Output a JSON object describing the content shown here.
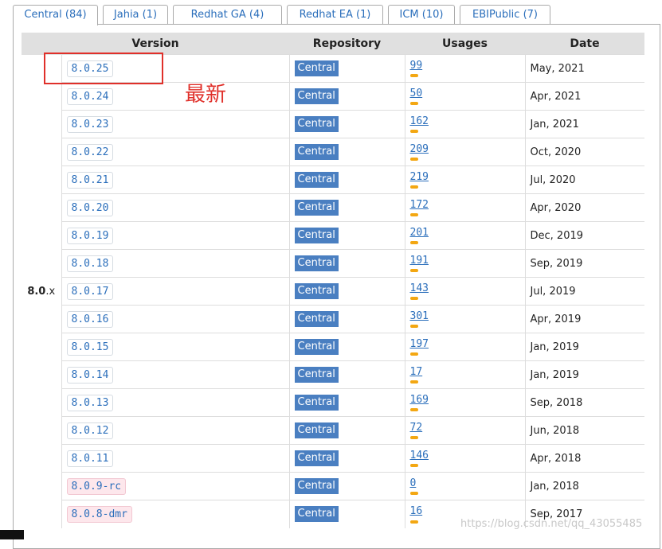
{
  "tabs": [
    {
      "label": "Central (84)",
      "active": true
    },
    {
      "label": "Jahia (1)",
      "active": false
    },
    {
      "label": "Redhat GA (4)",
      "active": false
    },
    {
      "label": "Redhat EA (1)",
      "active": false
    },
    {
      "label": "ICM (10)",
      "active": false
    },
    {
      "label": "EBIPublic (7)",
      "active": false
    }
  ],
  "table": {
    "headers": {
      "version": "Version",
      "repository": "Repository",
      "usages": "Usages",
      "date": "Date"
    },
    "group": {
      "major": "8.0",
      "suffix": ".x"
    },
    "rows": [
      {
        "version": "8.0.25",
        "repo": "Central",
        "usages": "99",
        "date": "May, 2021"
      },
      {
        "version": "8.0.24",
        "repo": "Central",
        "usages": "50",
        "date": "Apr, 2021"
      },
      {
        "version": "8.0.23",
        "repo": "Central",
        "usages": "162",
        "date": "Jan, 2021"
      },
      {
        "version": "8.0.22",
        "repo": "Central",
        "usages": "209",
        "date": "Oct, 2020"
      },
      {
        "version": "8.0.21",
        "repo": "Central",
        "usages": "219",
        "date": "Jul, 2020"
      },
      {
        "version": "8.0.20",
        "repo": "Central",
        "usages": "172",
        "date": "Apr, 2020"
      },
      {
        "version": "8.0.19",
        "repo": "Central",
        "usages": "201",
        "date": "Dec, 2019"
      },
      {
        "version": "8.0.18",
        "repo": "Central",
        "usages": "191",
        "date": "Sep, 2019"
      },
      {
        "version": "8.0.17",
        "repo": "Central",
        "usages": "143",
        "date": "Jul, 2019"
      },
      {
        "version": "8.0.16",
        "repo": "Central",
        "usages": "301",
        "date": "Apr, 2019"
      },
      {
        "version": "8.0.15",
        "repo": "Central",
        "usages": "197",
        "date": "Jan, 2019"
      },
      {
        "version": "8.0.14",
        "repo": "Central",
        "usages": "17",
        "date": "Jan, 2019"
      },
      {
        "version": "8.0.13",
        "repo": "Central",
        "usages": "169",
        "date": "Sep, 2018"
      },
      {
        "version": "8.0.12",
        "repo": "Central",
        "usages": "72",
        "date": "Jun, 2018"
      },
      {
        "version": "8.0.11",
        "repo": "Central",
        "usages": "146",
        "date": "Apr, 2018"
      },
      {
        "version": "8.0.9-rc",
        "repo": "Central",
        "usages": "0",
        "date": "Jan, 2018",
        "prerelease": true
      },
      {
        "version": "8.0.8-dmr",
        "repo": "Central",
        "usages": "16",
        "date": "Sep, 2017",
        "prerelease": true
      }
    ]
  },
  "annotation": {
    "label": "最新"
  },
  "watermark": "https://blog.csdn.net/qq_43055485",
  "colors": {
    "link": "#2a6ebb",
    "repo_badge": "#4a7fc1",
    "usage_bar": "#f3a712",
    "annotation": "#e0302a"
  }
}
